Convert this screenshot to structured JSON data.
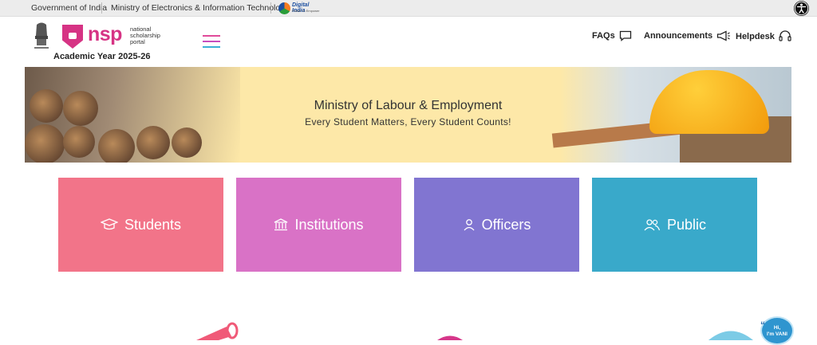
{
  "topbar": {
    "government": "Government of India",
    "ministry": "Ministry of Electronics & Information Technology",
    "digital_india": "Digital India",
    "digital_india_tagline": "Power To Empower"
  },
  "header": {
    "brand": "nsp",
    "brand_sub_1": "national",
    "brand_sub_2": "scholarship",
    "brand_sub_3": "portal",
    "academic_year": "Academic Year 2025-26",
    "nav": {
      "faqs": "FAQs",
      "announcements": "Announcements",
      "helpdesk": "Helpdesk"
    }
  },
  "banner": {
    "title": "Ministry of Labour & Employment",
    "subtitle": "Every Student Matters, Every Student Counts!"
  },
  "cards": [
    {
      "label": "Students",
      "color": "#f27489",
      "icon": "graduation-cap-icon"
    },
    {
      "label": "Institutions",
      "color": "#d972c6",
      "icon": "institution-building-icon"
    },
    {
      "label": "Officers",
      "color": "#8175d1",
      "icon": "user-icon"
    },
    {
      "label": "Public",
      "color": "#39a9ca",
      "icon": "users-icon"
    }
  ],
  "chatbot": {
    "greeting_1": "Hi,",
    "greeting_2": "I'm VANI"
  },
  "colors": {
    "brand_pink": "#d63384",
    "topbar_bg": "#ececec",
    "banner_bg": "#fde8a8"
  }
}
